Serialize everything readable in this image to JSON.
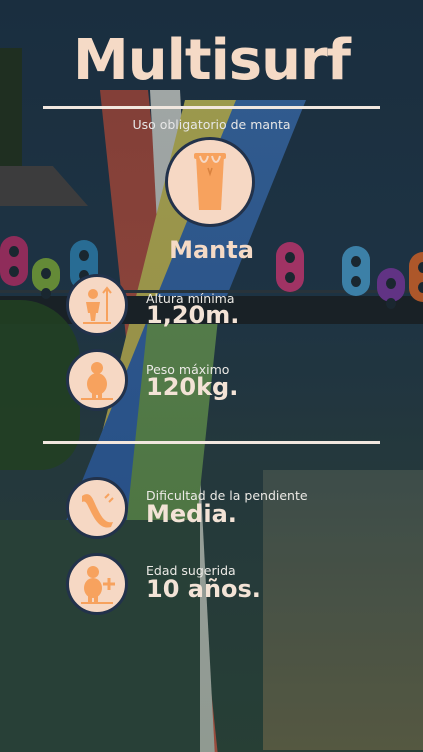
{
  "title": "Multisurf",
  "subtitle": "Uso obligatorio de manta",
  "equipment": {
    "label": "Manta",
    "icon": "tube-bag-icon"
  },
  "requirements": [
    {
      "label": "Altura mínima",
      "value": "1,20m.",
      "icon": "height-person-icon"
    },
    {
      "label": "Peso máximo",
      "value": "120kg.",
      "icon": "weight-person-icon"
    }
  ],
  "details": [
    {
      "label": "Dificultad de la pendiente",
      "value": "Media.",
      "icon": "slope-curve-icon"
    },
    {
      "label": "Edad sugerida",
      "value": "10 años.",
      "icon": "person-plus-icon"
    }
  ],
  "colors": {
    "accent": "#F7A25E",
    "title": "#F5DAC6",
    "icon_bg": "#F6D8C4",
    "icon_border": "#22324B"
  }
}
